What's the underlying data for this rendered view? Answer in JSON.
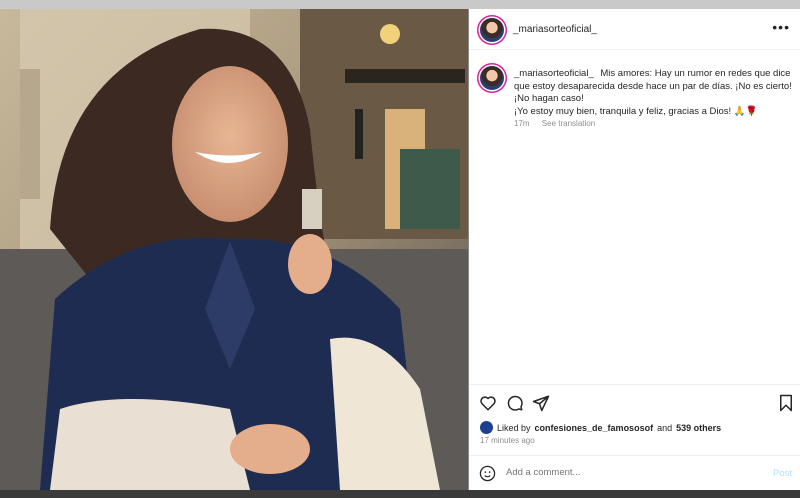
{
  "post": {
    "username": "_mariasorteoficial_",
    "more_label": "•••",
    "caption_user": "_mariasorteoficial_",
    "caption_lines": [
      "Mis amores: Hay un rumor en redes que dice que estoy desaparecida desde hace un par de días. ¡No es cierto!",
      "¡No hagan caso!",
      "¡Yo estoy muy bien, tranquila y feliz, gracias a Dios! 🙏🌹"
    ],
    "time": "17m",
    "see_translation": "See translation",
    "liked_prefix": "Liked by",
    "liked_user": "confesiones_de_famososof",
    "liked_and": "and",
    "liked_others": "539 others",
    "time_ago": "17 minutes ago",
    "comment_placeholder": "Add a comment...",
    "post_label": "Post"
  },
  "icons": {
    "like": "heart-icon",
    "comment": "comment-icon",
    "share": "share-icon",
    "save": "bookmark-icon",
    "emoji": "emoji-icon"
  }
}
